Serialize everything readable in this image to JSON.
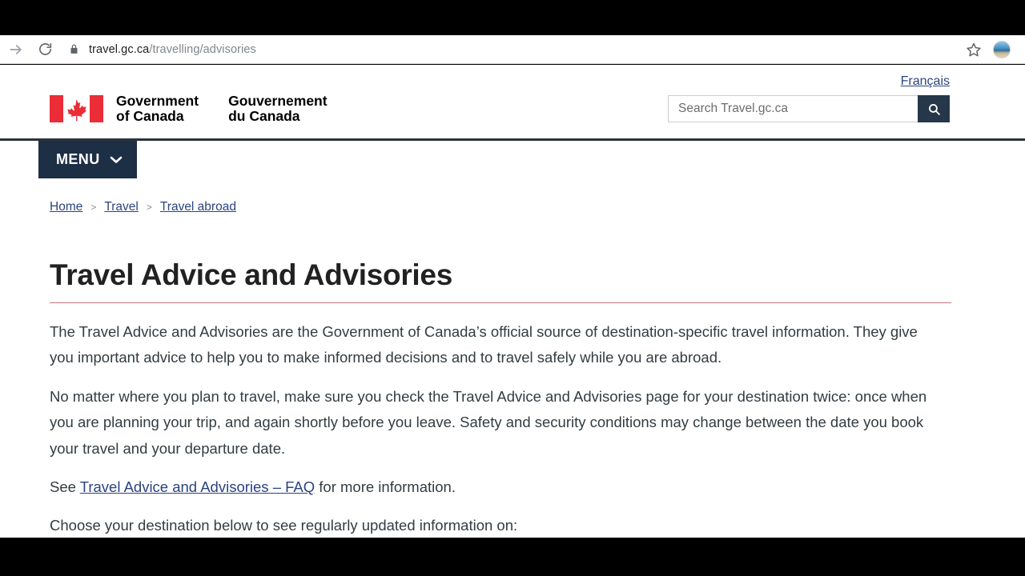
{
  "browser": {
    "forward_icon": "arrow-right-icon",
    "reload_icon": "reload-icon",
    "lock_icon": "lock-icon",
    "url_host": "travel.gc.ca",
    "url_path": "/travelling/advisories",
    "bookmark_icon": "star-icon",
    "profile_icon": "avatar"
  },
  "header": {
    "language_toggle": "Français",
    "wordmark_en_line1": "Government",
    "wordmark_en_line2": "of Canada",
    "wordmark_fr_line1": "Gouvernement",
    "wordmark_fr_line2": "du Canada",
    "flag_icon": "canada-flag-icon",
    "search": {
      "placeholder": "Search Travel.gc.ca",
      "value": "",
      "button_icon": "search-icon"
    }
  },
  "nav": {
    "menu_label": "MENU",
    "menu_chevron_icon": "chevron-down-icon"
  },
  "breadcrumb": {
    "separator": ">",
    "items": [
      {
        "label": "Home"
      },
      {
        "label": "Travel"
      },
      {
        "label": "Travel abroad"
      }
    ]
  },
  "main": {
    "title": "Travel Advice and Advisories",
    "paragraph_1": "The Travel Advice and Advisories are the Government of Canada’s official source of destination-specific travel information. They give you important advice to help you to make informed decisions and to travel safely while you are abroad.",
    "paragraph_2": "No matter where you plan to travel, make sure you check the Travel Advice and Advisories page for your destination twice: once when you are planning your trip, and again shortly before you leave. Safety and security conditions may change between the date you book your travel and your departure date.",
    "faq_line_prefix": "See ",
    "faq_link": "Travel Advice and Advisories – FAQ",
    "faq_line_suffix": " for more information.",
    "paragraph_4": "Choose your destination below to see regularly updated information on:"
  },
  "colors": {
    "navy": "#26374a",
    "menu_navy": "#1d2f45",
    "link_blue": "#2b4380",
    "flag_red": "#ea2d37",
    "title_rule": "#af4853",
    "header_rule": "#2b333b",
    "body_text": "#333c42"
  }
}
